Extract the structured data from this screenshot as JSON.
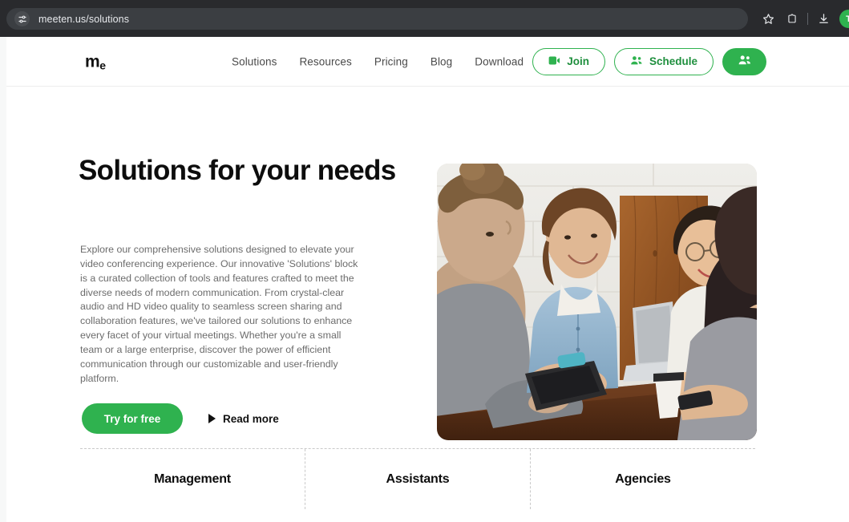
{
  "browser": {
    "url": "meeten.us/solutions",
    "site_icon": "tune-sliders-icon",
    "actions": [
      {
        "name": "bookmark-star-icon",
        "label": "Bookmark this tab"
      },
      {
        "name": "extensions-icon",
        "label": "Extensions"
      },
      {
        "name": "downloads-icon",
        "label": "Downloads"
      }
    ],
    "avatar_initial": "T"
  },
  "site_header": {
    "logo": {
      "main": "m",
      "sub": "e"
    },
    "nav": [
      {
        "label": "Solutions"
      },
      {
        "label": "Resources"
      },
      {
        "label": "Pricing"
      },
      {
        "label": "Blog"
      },
      {
        "label": "Download"
      }
    ],
    "join_button": {
      "label": "Join",
      "icon": "video-camera-icon"
    },
    "schedule_button": {
      "label": "Schedule",
      "icon": "people-group-icon"
    },
    "account_button": {
      "icon": "people-group-icon"
    }
  },
  "hero": {
    "title": "Solutions for your needs",
    "paragraph": "Explore our comprehensive solutions designed to elevate your video conferencing experience. Our innovative 'Solutions' block is a curated collection of tools and features crafted to meet the diverse needs of modern communication. From crystal-clear audio and HD video quality to seamless screen sharing and collaboration features, we've tailored our solutions to enhance every facet of your virtual meetings. Whether you're a small team or a large enterprise, discover the power of efficient communication through our customizable and user-friendly platform.",
    "primary_cta": "Try for free",
    "secondary_cta": "Read more",
    "secondary_cta_icon": "play-triangle-icon",
    "image_alt": "four-people-collaborating-around-table-photo"
  },
  "tabs": [
    {
      "label": "Management"
    },
    {
      "label": "Assistants"
    },
    {
      "label": "Agencies"
    }
  ],
  "colors": {
    "brand_green": "#2fb24f",
    "brand_green_dark": "#1f8f3e",
    "chrome_bg": "#292a2d",
    "omnibox_bg": "#3b3e42",
    "body_text": "#6c6c6c",
    "heading": "#0d0d0d",
    "page_bg": "#f7f8f8"
  }
}
